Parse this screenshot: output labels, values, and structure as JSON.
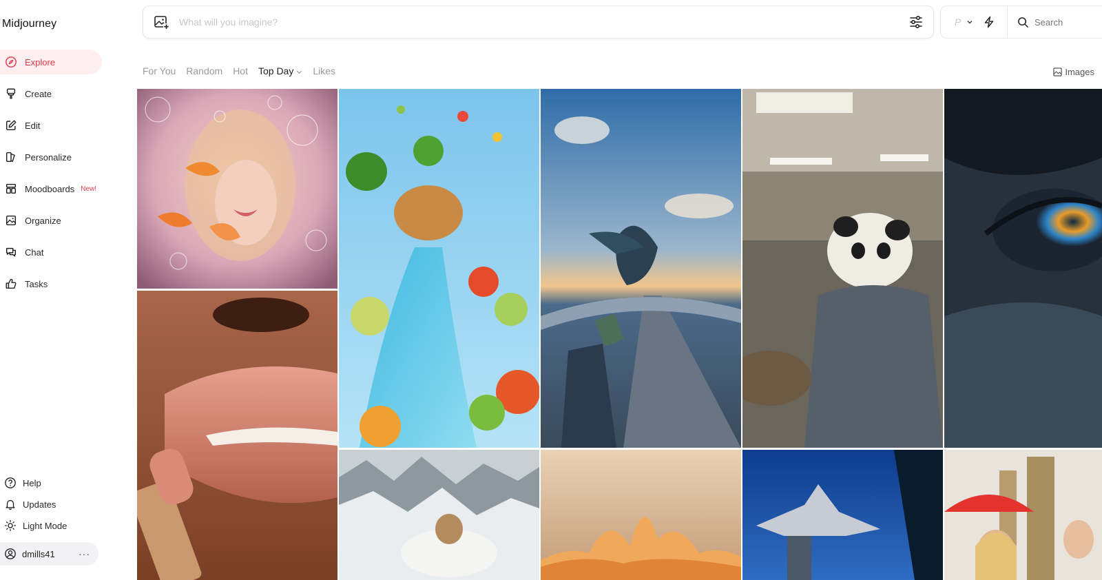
{
  "app": {
    "title": "Midjourney"
  },
  "sidebar": {
    "items": [
      {
        "label": "Explore",
        "icon": "compass-icon",
        "active": true
      },
      {
        "label": "Create",
        "icon": "brush-icon"
      },
      {
        "label": "Edit",
        "icon": "edit-icon"
      },
      {
        "label": "Personalize",
        "icon": "personalize-icon"
      },
      {
        "label": "Moodboards",
        "icon": "moodboard-icon",
        "badge": "New!"
      },
      {
        "label": "Organize",
        "icon": "image-icon"
      },
      {
        "label": "Chat",
        "icon": "chat-icon"
      },
      {
        "label": "Tasks",
        "icon": "thumbs-up-icon"
      }
    ],
    "bottom": [
      {
        "label": "Help",
        "icon": "help-icon"
      },
      {
        "label": "Updates",
        "icon": "bell-icon"
      },
      {
        "label": "Light Mode",
        "icon": "sun-icon"
      }
    ],
    "user": {
      "name": "dmills41",
      "menu": "···"
    }
  },
  "prompt": {
    "placeholder": "What will you imagine?"
  },
  "toolbar": {
    "mode_glyph": "P",
    "search_label": "Search"
  },
  "tabs": [
    {
      "label": "For You"
    },
    {
      "label": "Random"
    },
    {
      "label": "Hot"
    },
    {
      "label": "Top Day",
      "active": true
    },
    {
      "label": "Likes"
    }
  ],
  "view_toggle": {
    "label": "Images"
  },
  "accent_color": "#e53a4a",
  "gallery": [
    {
      "subject": "woman with goldfish and bubbles"
    },
    {
      "subject": "lipstick on glossy lips"
    },
    {
      "subject": "vegetables and fruit river"
    },
    {
      "subject": "snowy mountains with winged figure"
    },
    {
      "subject": "anime girl skateboarding over city"
    },
    {
      "subject": "golden glowing waves"
    },
    {
      "subject": "panda with headphones in office"
    },
    {
      "subject": "floating mountain island"
    },
    {
      "subject": "close-up eye with golden iris"
    },
    {
      "subject": "women with red umbrella in London"
    }
  ]
}
